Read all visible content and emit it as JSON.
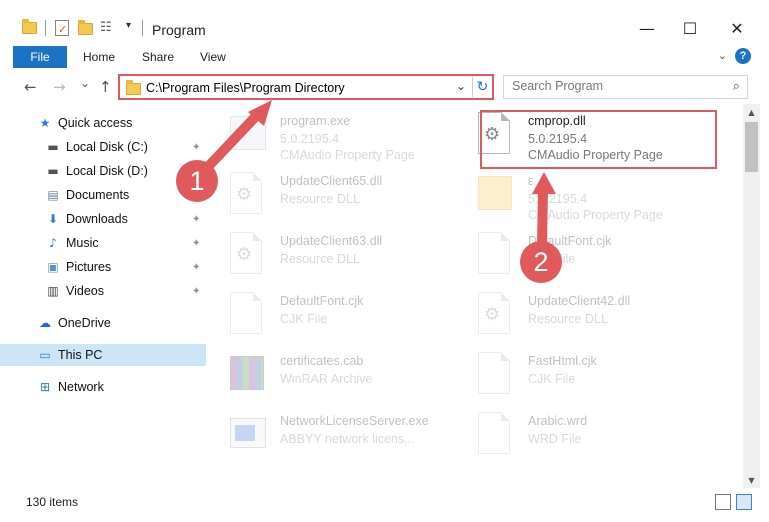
{
  "window": {
    "title": "Program",
    "minimize": "—",
    "maximize": "☐",
    "close": "✕"
  },
  "ribbon": {
    "tabs": [
      "File",
      "Home",
      "Share",
      "View"
    ],
    "help": "?",
    "collapse": "⌄"
  },
  "address": {
    "path": "C:\\Program Files\\Program Directory",
    "search_placeholder": "Search Program",
    "back": "←",
    "forward": "→",
    "recent": "⌄",
    "up": "↑",
    "dropdown": "⌄",
    "refresh": "↻"
  },
  "nav": {
    "items": [
      {
        "label": "Quick access",
        "icon": "star-icon",
        "glyph": "★",
        "color": "#2b7bd4"
      },
      {
        "label": "Local Disk (C:)",
        "icon": "drive-icon",
        "glyph": "▬",
        "color": "#555555",
        "pinned": true
      },
      {
        "label": "Local Disk (D:)",
        "icon": "drive-icon",
        "glyph": "▬",
        "color": "#555555"
      },
      {
        "label": "Documents",
        "icon": "document-icon",
        "glyph": "▤",
        "color": "#6a7f99",
        "pinned": true
      },
      {
        "label": "Downloads",
        "icon": "download-icon",
        "glyph": "⬇",
        "color": "#2b7bd4",
        "pinned": true
      },
      {
        "label": "Music",
        "icon": "music-icon",
        "glyph": "♪",
        "color": "#2b7bd4",
        "pinned": true
      },
      {
        "label": "Pictures",
        "icon": "pictures-icon",
        "glyph": "▣",
        "color": "#5b8fc8",
        "pinned": true
      },
      {
        "label": "Videos",
        "icon": "videos-icon",
        "glyph": "▥",
        "color": "#444444",
        "pinned": true
      },
      {
        "label": "OneDrive",
        "icon": "cloud-icon",
        "glyph": "☁",
        "color": "#1f6cc4"
      },
      {
        "label": "This PC",
        "icon": "computer-icon",
        "glyph": "▭",
        "color": "#2b7bd4"
      },
      {
        "label": "Network",
        "icon": "network-icon",
        "glyph": "⊞",
        "color": "#2b7bd4"
      }
    ],
    "pin_glyph": "📌"
  },
  "files": [
    {
      "name": "program.exe",
      "line2": "5.0.2195.4",
      "line3": "CMAudio Property Page",
      "kind": "exe",
      "faded": true
    },
    {
      "name": "cmprop.dll",
      "line2": "5.0.2195.4",
      "line3": "CMAudio Property Page",
      "kind": "dll",
      "faded": false
    },
    {
      "name": "UpdateClient65.dll",
      "line2": "Resource DLL",
      "line3": "",
      "kind": "dll",
      "faded": true
    },
    {
      "name": "ε",
      "line2": "5.0.2195.4",
      "line3": "CMAudio Property Page",
      "kind": "folder",
      "faded": true
    },
    {
      "name": "UpdateClient63.dll",
      "line2": "Resource DLL",
      "line3": "",
      "kind": "dll",
      "faded": true
    },
    {
      "name": "DefaultFont.cjk",
      "line2": "CJK File",
      "line3": "",
      "kind": "doc",
      "faded": true
    },
    {
      "name": "DefaultFont.cjk",
      "line2": "CJK File",
      "line3": "",
      "kind": "doc",
      "faded": true
    },
    {
      "name": "UpdateClient42.dll",
      "line2": "Resource DLL",
      "line3": "",
      "kind": "dll",
      "faded": true
    },
    {
      "name": "certificates.cab",
      "line2": "WinRAR Archive",
      "line3": "",
      "kind": "cab",
      "faded": true
    },
    {
      "name": "FastHtml.cjk",
      "line2": "CJK File",
      "line3": "",
      "kind": "doc",
      "faded": true
    },
    {
      "name": "NetworkLicenseServer.exe",
      "line2": "ABBYY network licens...",
      "line3": "",
      "kind": "app",
      "faded": true
    },
    {
      "name": "Arabic.wrd",
      "line2": "WRD File",
      "line3": "",
      "kind": "doc",
      "faded": true
    }
  ],
  "status": {
    "item_count": "130 items"
  },
  "annotations": {
    "badge1": "1",
    "badge2": "2"
  },
  "colors": {
    "accent": "#1c72c4",
    "annotation": "#e0595c",
    "selected": "#cde6f7"
  }
}
